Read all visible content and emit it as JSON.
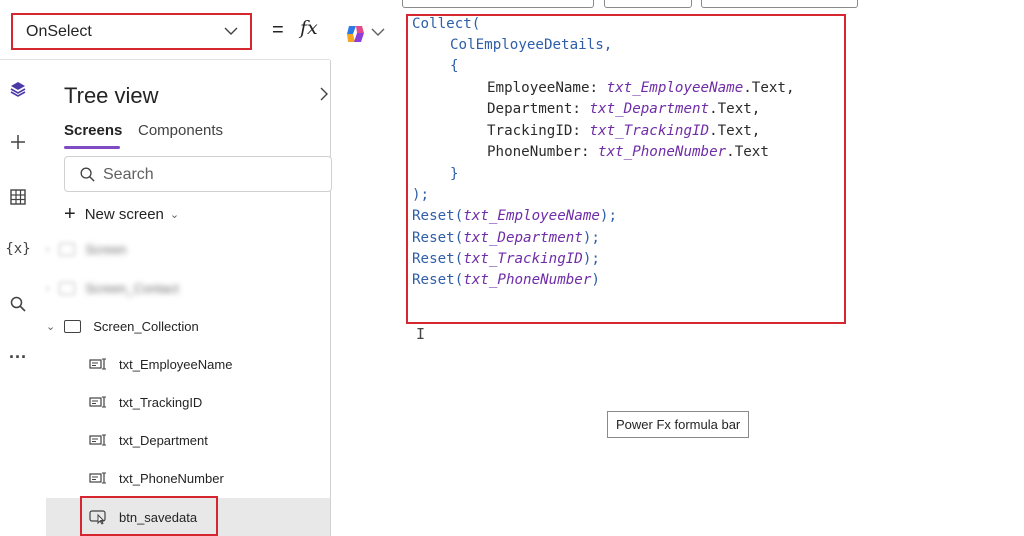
{
  "formula_bar": {
    "property": "OnSelect",
    "equals": "=",
    "fx": "fx",
    "copilot_icon": "copilot-icon",
    "tooltip": "Power Fx formula bar"
  },
  "rail": {
    "icons": [
      "layers-icon",
      "plus-icon",
      "table-icon",
      "variables-icon",
      "search-icon",
      "more-icon"
    ],
    "variables_label": "{x}",
    "more_label": "..."
  },
  "tree_view": {
    "title": "Tree view",
    "tabs": [
      "Screens",
      "Components"
    ],
    "search_placeholder": "Search",
    "new_screen": "New screen",
    "screens": [
      {
        "label": "Screen",
        "blurred": true
      },
      {
        "label": "Screen_Contact",
        "blurred": true
      },
      {
        "label": "Screen_Collection",
        "blurred": false
      }
    ],
    "controls": [
      "txt_EmployeeName",
      "txt_TrackingID",
      "txt_Department",
      "txt_PhoneNumber"
    ],
    "selected_control": "btn_savedata"
  },
  "code": {
    "l1": "Collect(",
    "l2": "ColEmployeeDetails,",
    "l3": "{",
    "l4_key": "EmployeeName: ",
    "l4_var": "txt_EmployeeName",
    "l4_tail": ".Text,",
    "l5_key": "Department: ",
    "l5_var": "txt_Department",
    "l5_tail": ".Text,",
    "l6_key": "TrackingID: ",
    "l6_var": "txt_TrackingID",
    "l6_tail": ".Text,",
    "l7_key": "PhoneNumber: ",
    "l7_var": "txt_PhoneNumber",
    "l7_tail": ".Text",
    "l8": "}",
    "l9": ");",
    "reset_fn": "Reset(",
    "r1_var": "txt_EmployeeName",
    "r1_tail": ");",
    "r2_var": "txt_Department",
    "r2_tail": ");",
    "r3_var": "txt_TrackingID",
    "r3_tail": ");",
    "r4_var": "txt_PhoneNumber",
    "r4_tail": ")"
  },
  "colors": {
    "highlight_border": "#d6262f",
    "function": "#2e5ea8",
    "variable": "#6f2da8",
    "accent": "#7f4bc3"
  }
}
